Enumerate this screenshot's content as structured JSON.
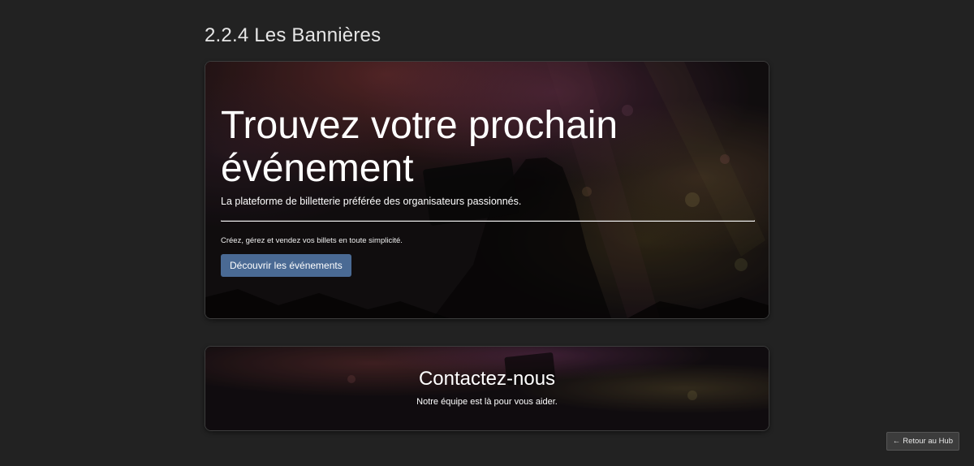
{
  "section": {
    "title": "2.2.4 Les Bannières"
  },
  "hero_banner": {
    "heading": "Trouvez votre prochain événement",
    "lead": "La plateforme de billetterie préférée des organisateurs passionnés.",
    "text": "Créez, gérez et vendez vos billets en toute simplicité.",
    "button_label": "Découvrir les événements",
    "button_color": "#4a6a94",
    "background": "concert-crowd-photo"
  },
  "contact_banner": {
    "title": "Contactez-nous",
    "subtitle": "Notre équipe est là pour vous aider.",
    "background": "concert-crowd-photo"
  },
  "nav": {
    "back_arrow": "←",
    "back_label": "Retour au Hub"
  },
  "colors": {
    "page_background": "#222222",
    "banner_border": "#3d3d3d"
  }
}
